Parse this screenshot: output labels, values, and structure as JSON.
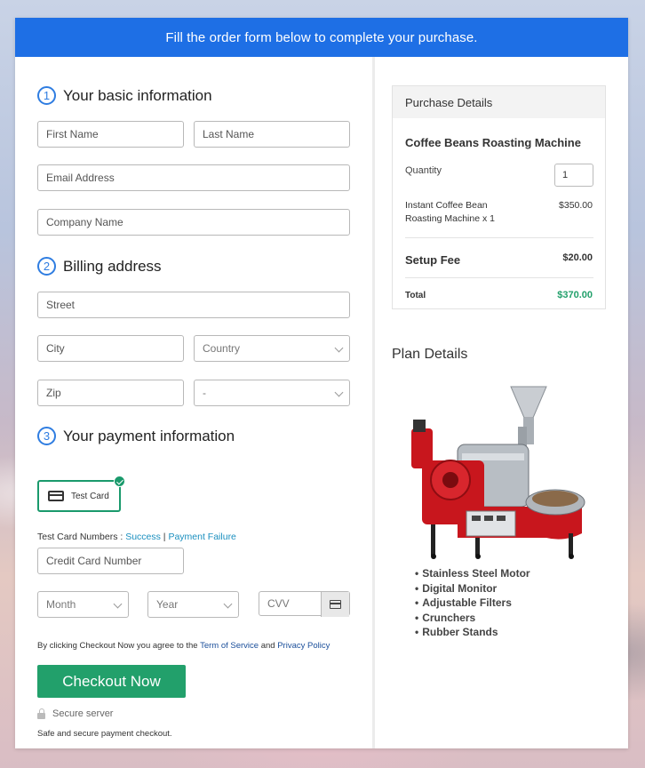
{
  "header": {
    "title": "Fill the order form below to complete your purchase."
  },
  "sections": {
    "basic": {
      "number": "1",
      "title": "Your basic information"
    },
    "billing": {
      "number": "2",
      "title": "Billing address"
    },
    "payment": {
      "number": "3",
      "title": "Your payment information"
    }
  },
  "fields": {
    "first_name": "First Name",
    "last_name": "Last Name",
    "email": "Email Address",
    "company": "Company Name",
    "street": "Street",
    "city": "City",
    "country": "Country",
    "zip": "Zip",
    "state": "-",
    "card_number": "Credit Card Number",
    "month": "Month",
    "year": "Year",
    "cvv": "CVV"
  },
  "payment": {
    "method_label": "Test Card",
    "test_numbers_label": "Test Card Numbers : ",
    "success_link": "Success",
    "separator": " | ",
    "failure_link": "Payment Failure"
  },
  "agreement": {
    "prefix": "By clicking Checkout Now you agree to the ",
    "terms_link": "Term of Service",
    "and": " and ",
    "privacy_link": "Privacy Policy"
  },
  "checkout": {
    "button_label": "Checkout Now",
    "secure_label": "Secure server",
    "footer_note": "Safe and secure payment checkout."
  },
  "purchase": {
    "heading": "Purchase Details",
    "product_name": "Coffee Beans Roasting Machine",
    "quantity_label": "Quantity",
    "quantity_value": "1",
    "line_item_line1": "Instant Coffee Bean",
    "line_item_line2": "Roasting Machine x 1",
    "line_item_price": "$350.00",
    "setup_fee_label": "Setup Fee",
    "setup_fee_value": "$20.00",
    "total_label": "Total",
    "total_value": "$370.00",
    "total_color": "#22a06b"
  },
  "plan": {
    "title": "Plan Details",
    "features": [
      "Stainless Steel Motor",
      "Digital Monitor",
      "Adjustable Filters",
      "Crunchers",
      "Rubber Stands"
    ]
  },
  "colors": {
    "header": "#1e6fe5",
    "accent": "#22a06b",
    "step": "#2f7de1"
  }
}
